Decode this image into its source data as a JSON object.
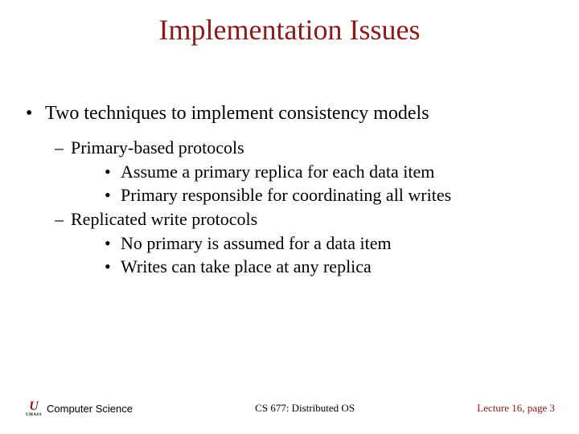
{
  "title": "Implementation Issues",
  "main": {
    "text": "Two techniques to implement consistency models",
    "subs": [
      {
        "text": "Primary-based protocols",
        "points": [
          "Assume a primary replica for each data item",
          "Primary responsible for coordinating all writes"
        ]
      },
      {
        "text": "Replicated write protocols",
        "points": [
          "No primary is assumed for a data item",
          "Writes can take place at any replica"
        ]
      }
    ]
  },
  "footer": {
    "logo_glyph": "U",
    "logo_text": "UMASS",
    "dept": "Computer Science",
    "course": "CS 677: Distributed OS",
    "page": "Lecture 16, page 3"
  }
}
